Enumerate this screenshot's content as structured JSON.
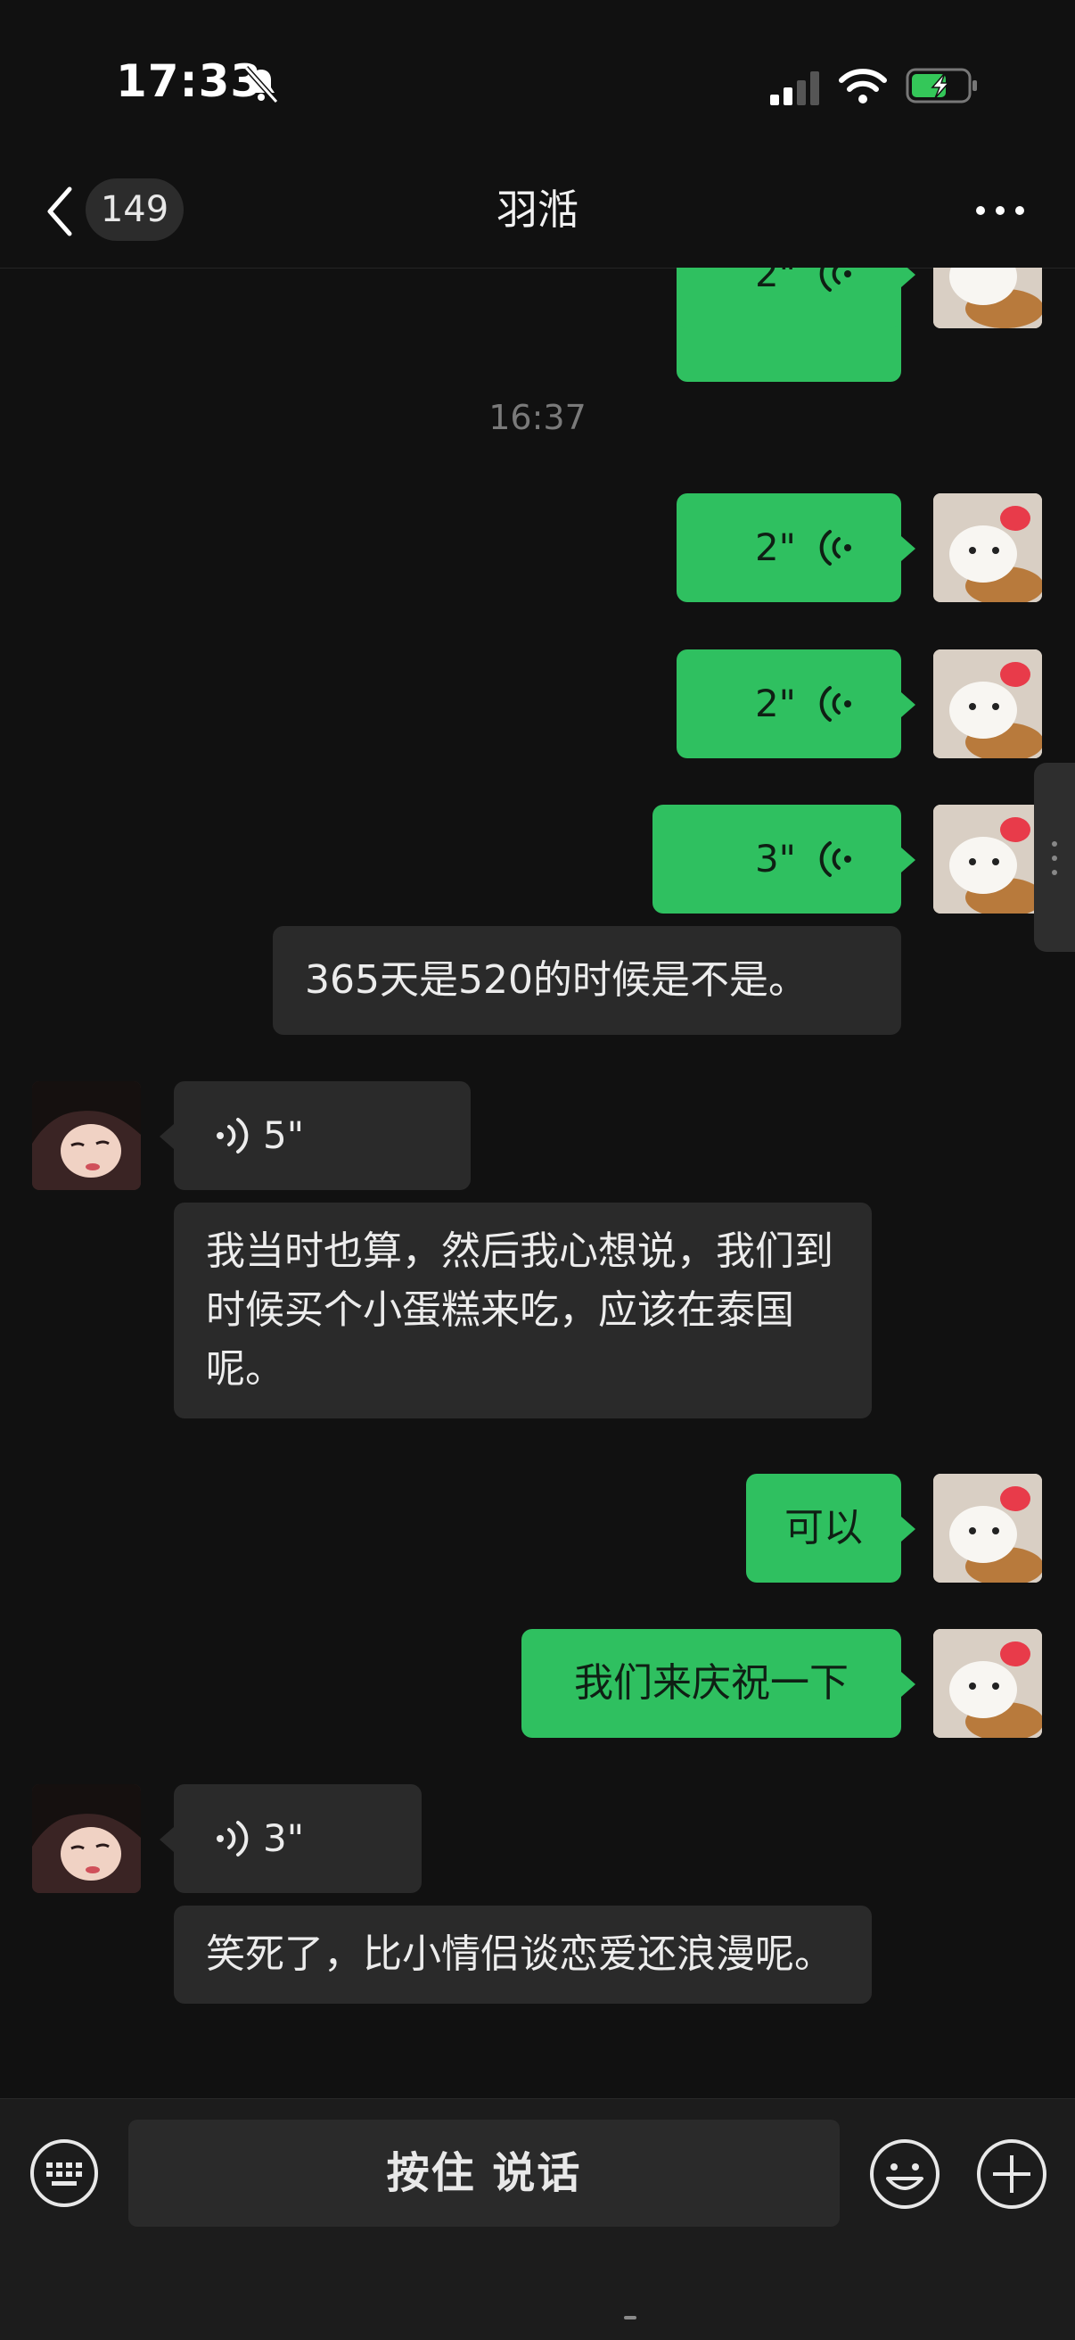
{
  "status_bar": {
    "time": "17:33"
  },
  "header": {
    "back_count": "149",
    "title": "羽湉"
  },
  "timestamp": "16:37",
  "messages": [
    {
      "from": "me",
      "type": "voice",
      "duration": "2\""
    },
    {
      "from": "me",
      "type": "voice",
      "duration": "2\""
    },
    {
      "from": "me",
      "type": "voice",
      "duration": "2\""
    },
    {
      "from": "me",
      "type": "voice",
      "duration": "3\"",
      "transcript": "365天是520的时候是不是。"
    },
    {
      "from": "them",
      "type": "voice",
      "duration": "5\"",
      "transcript": "我当时也算，然后我心想说，我们到时候买个小蛋糕来吃，应该在泰国呢。"
    },
    {
      "from": "me",
      "type": "text",
      "text": "可以"
    },
    {
      "from": "me",
      "type": "text",
      "text": "我们来庆祝一下"
    },
    {
      "from": "them",
      "type": "voice",
      "duration": "3\"",
      "transcript": "笑死了，比小情侣谈恋爱还浪漫呢。"
    }
  ],
  "input_bar": {
    "hold_to_talk": "按住 说话"
  },
  "colors": {
    "background": "#111111",
    "my_bubble": "#2fc060",
    "their_bubble": "#2a2a2a"
  },
  "icons": [
    "bell-muted-icon",
    "signal-icon",
    "wifi-icon",
    "battery-charging-icon",
    "back-chevron-icon",
    "more-icon",
    "keyboard-icon",
    "emoji-icon",
    "plus-icon",
    "voice-wave-icon"
  ]
}
